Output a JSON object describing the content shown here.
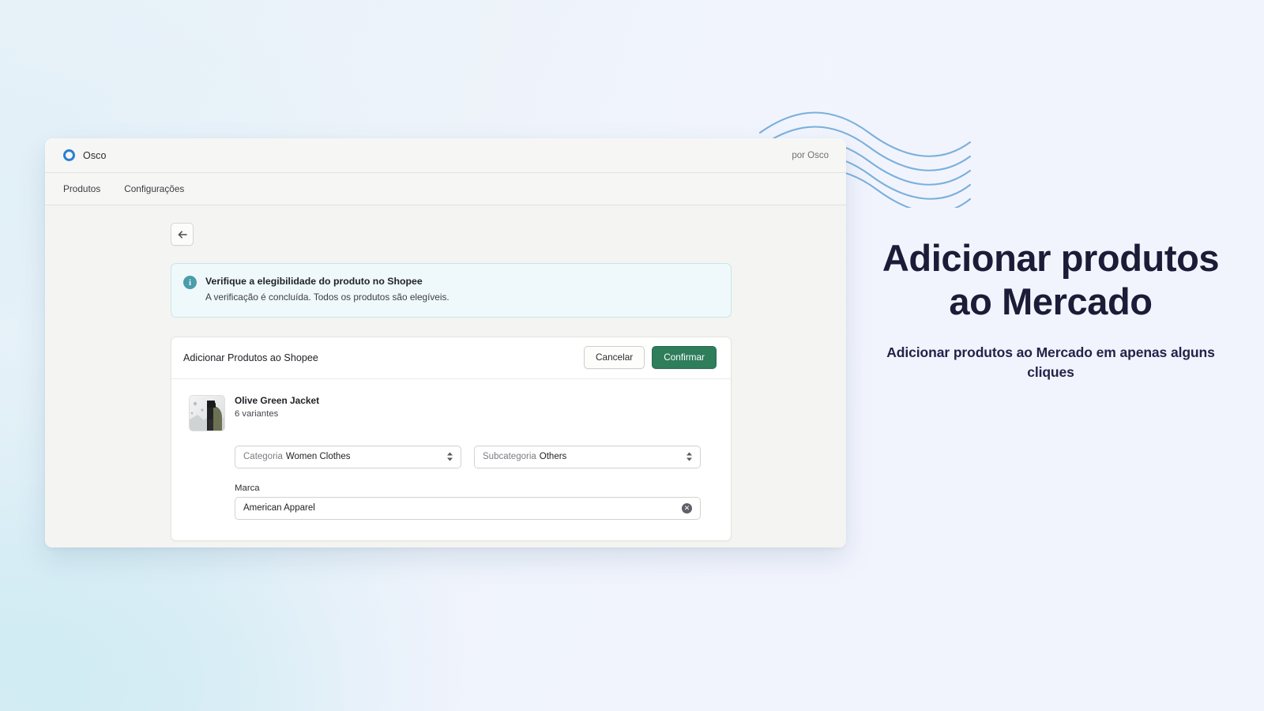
{
  "window": {
    "brand_name": "Osco",
    "brand_mark_color": "#2b7fd4",
    "attribution": "por Osco",
    "nav": [
      {
        "label": "Produtos"
      },
      {
        "label": "Configurações"
      }
    ]
  },
  "toolbar": {
    "back_icon": "arrow-left-icon"
  },
  "banner": {
    "icon": "info-icon",
    "icon_color": "#4a9dab",
    "background": "#eff9fb",
    "title": "Verifique a elegibilidade do produto no Shopee",
    "description": "A verificação é concluída. Todos os produtos são elegíveis."
  },
  "card": {
    "title": "Adicionar Produtos ao Shopee",
    "cancel_label": "Cancelar",
    "confirm_label": "Confirmar",
    "confirm_color": "#2e7d5b",
    "product": {
      "thumbnail_alt": "product-thumbnail",
      "name": "Olive Green Jacket",
      "variants": "6 variantes"
    },
    "fields": {
      "category": {
        "prefix": "Categoria",
        "value": "Women Clothes",
        "stepper_icon": "updown-stepper-icon"
      },
      "subcategory": {
        "prefix": "Subcategoria",
        "value": "Others",
        "stepper_icon": "updown-stepper-icon"
      },
      "brand": {
        "label": "Marca",
        "value": "American Apparel",
        "clear_icon": "clear-circle-icon",
        "clear_glyph": "✕"
      }
    }
  },
  "marketing": {
    "title": "Adicionar produtos ao Mercado",
    "subtitle": "Adicionar produtos ao Mercado em apenas alguns cliques"
  },
  "decoration": {
    "wave_icon": "wave-lines-icon",
    "wave_color": "#7ab0dd"
  }
}
